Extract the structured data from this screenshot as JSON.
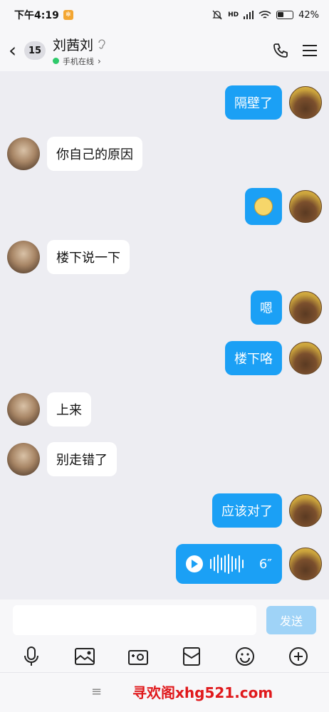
{
  "status_bar": {
    "time": "下午4:19",
    "network": "HD",
    "battery": "42%"
  },
  "header": {
    "unread_count": "15",
    "title": "刘茜刘",
    "status": "手机在线",
    "status_color": "#2ec96b"
  },
  "messages": [
    {
      "side": "right",
      "type": "text",
      "text": "隔壁了"
    },
    {
      "side": "left",
      "type": "text",
      "text": "你自己的原因"
    },
    {
      "side": "right",
      "type": "emoji",
      "text": ""
    },
    {
      "side": "left",
      "type": "text",
      "text": "楼下说一下"
    },
    {
      "side": "right",
      "type": "text",
      "text": "嗯"
    },
    {
      "side": "right",
      "type": "text",
      "text": "楼下咯"
    },
    {
      "side": "left",
      "type": "text",
      "text": "上来"
    },
    {
      "side": "left",
      "type": "text",
      "text": "别走错了"
    },
    {
      "side": "right",
      "type": "text",
      "text": "应该对了"
    },
    {
      "side": "right",
      "type": "voice",
      "text": "6″"
    }
  ],
  "input": {
    "placeholder": "",
    "send_label": "发送"
  },
  "toolbar": [
    "mic-icon",
    "image-icon",
    "camera-icon",
    "red-packet-icon",
    "emoji-icon",
    "plus-icon"
  ],
  "bottom": {
    "menu_glyph": "≡",
    "watermark": "寻欢阁xhg521.com"
  },
  "colors": {
    "bubble_me": "#1ba0f5",
    "bubble_other": "#ffffff",
    "background": "#ededf2"
  }
}
